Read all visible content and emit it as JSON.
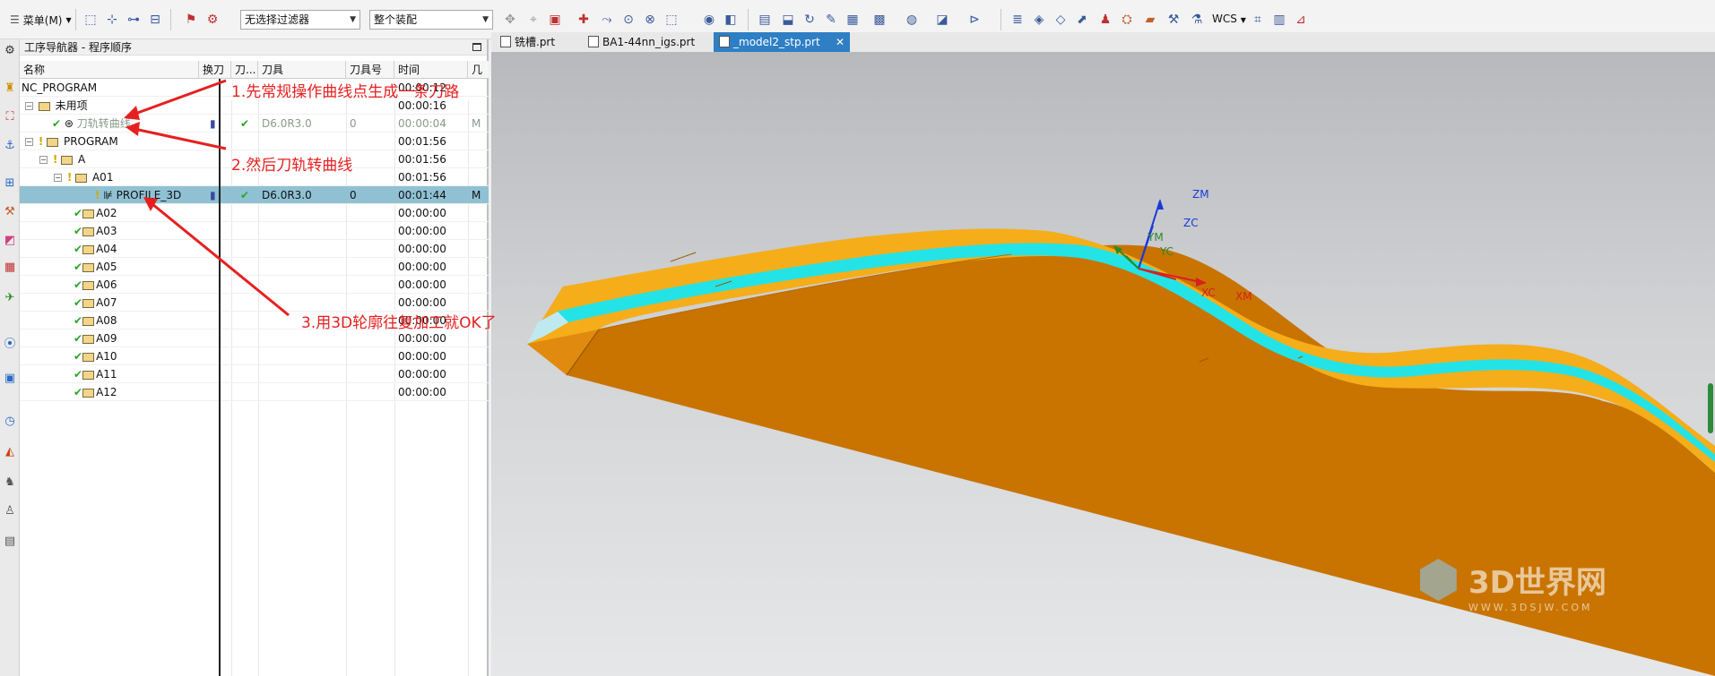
{
  "toolbar": {
    "menu_label": "菜单(M)",
    "filter_select": "无选择过滤器",
    "assembly_select": "整个装配",
    "wcs_label": "WCS"
  },
  "navigator": {
    "title": "工序导航器 - 程序顺序",
    "columns": [
      "名称",
      "换刀",
      "刀...",
      "刀具",
      "刀具号",
      "时间",
      "几"
    ],
    "rows": [
      {
        "name": "NC_PROGRAM",
        "time": "00:00:12"
      },
      {
        "name": "未用项",
        "time": "00:00:16"
      },
      {
        "name": "刀轨转曲线",
        "tool": "D6.0R3.0",
        "toolno": "0",
        "time": "00:00:04",
        "geom": "M"
      },
      {
        "name": "PROGRAM",
        "time": "00:01:56"
      },
      {
        "name": "A",
        "time": "00:01:56"
      },
      {
        "name": "A01",
        "time": "00:01:56"
      },
      {
        "name": "PROFILE_3D",
        "tool": "D6.0R3.0",
        "toolno": "0",
        "time": "00:01:44",
        "geom": "M"
      },
      {
        "name": "A02",
        "time": "00:00:00"
      },
      {
        "name": "A03",
        "time": "00:00:00"
      },
      {
        "name": "A04",
        "time": "00:00:00"
      },
      {
        "name": "A05",
        "time": "00:00:00"
      },
      {
        "name": "A06",
        "time": "00:00:00"
      },
      {
        "name": "A07",
        "time": "00:00:00"
      },
      {
        "name": "A08",
        "time": "00:00:00"
      },
      {
        "name": "A09",
        "time": "00:00:00"
      },
      {
        "name": "A10",
        "time": "00:00:00"
      },
      {
        "name": "A11",
        "time": "00:00:00"
      },
      {
        "name": "A12",
        "time": "00:00:00"
      }
    ]
  },
  "tabs": [
    {
      "label": "铣槽.prt",
      "active": false
    },
    {
      "label": "BA1-44nn_igs.prt",
      "active": false
    },
    {
      "label": "_model2_stp.prt",
      "active": true
    }
  ],
  "annotations": [
    "1.先常规操作曲线点生成一条刀路",
    "2.然后刀轨转曲线",
    "3.用3D轮廓往复加工就OK了"
  ],
  "axes": {
    "zm": "ZM",
    "zc": "ZC",
    "ym": "YM",
    "yc": "YC",
    "xc": "XC",
    "xm": "XM"
  },
  "watermark": {
    "brand": "3D世界网",
    "url": "WWW.3DSJW.COM"
  },
  "colors": {
    "part": "#d17a00",
    "part_top": "#f5ad1a",
    "toolpath": "#22e5e5",
    "selected_row": "#8fc1d3",
    "annotation": "#e62020"
  }
}
